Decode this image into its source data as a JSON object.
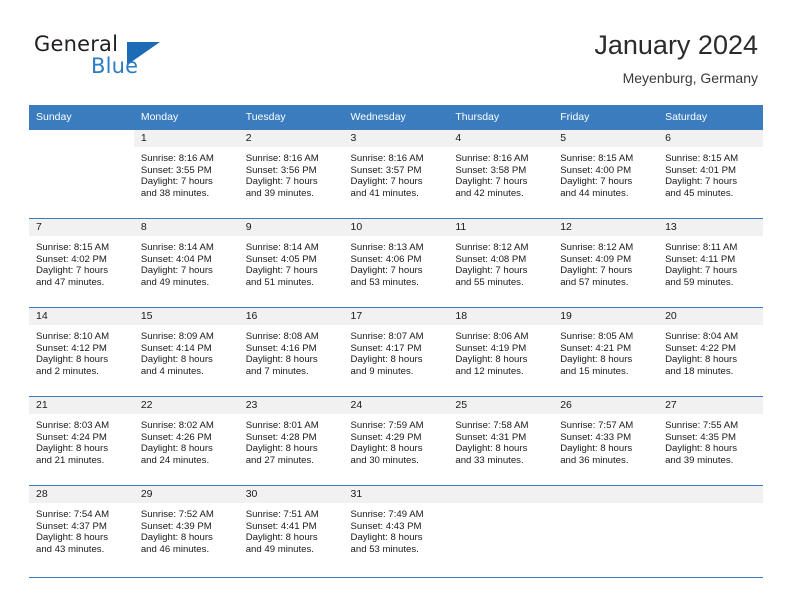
{
  "brand": {
    "line1": "General",
    "line2": "Blue",
    "accent_color": "#1b6cb5",
    "text_color": "#231f20"
  },
  "header": {
    "title": "January 2024",
    "subtitle": "Meyenburg, Germany"
  },
  "calendar": {
    "header_color": "#3a7cbe",
    "daynum_band_color": "#f1f1f1",
    "weekday_headers": [
      "Sunday",
      "Monday",
      "Tuesday",
      "Wednesday",
      "Thursday",
      "Friday",
      "Saturday"
    ],
    "weeks": [
      [
        {
          "day": "",
          "blank": true,
          "lines": []
        },
        {
          "day": "1",
          "lines": [
            "Sunrise: 8:16 AM",
            "Sunset: 3:55 PM",
            "Daylight: 7 hours",
            "and 38 minutes."
          ]
        },
        {
          "day": "2",
          "lines": [
            "Sunrise: 8:16 AM",
            "Sunset: 3:56 PM",
            "Daylight: 7 hours",
            "and 39 minutes."
          ]
        },
        {
          "day": "3",
          "lines": [
            "Sunrise: 8:16 AM",
            "Sunset: 3:57 PM",
            "Daylight: 7 hours",
            "and 41 minutes."
          ]
        },
        {
          "day": "4",
          "lines": [
            "Sunrise: 8:16 AM",
            "Sunset: 3:58 PM",
            "Daylight: 7 hours",
            "and 42 minutes."
          ]
        },
        {
          "day": "5",
          "lines": [
            "Sunrise: 8:15 AM",
            "Sunset: 4:00 PM",
            "Daylight: 7 hours",
            "and 44 minutes."
          ]
        },
        {
          "day": "6",
          "lines": [
            "Sunrise: 8:15 AM",
            "Sunset: 4:01 PM",
            "Daylight: 7 hours",
            "and 45 minutes."
          ]
        }
      ],
      [
        {
          "day": "7",
          "lines": [
            "Sunrise: 8:15 AM",
            "Sunset: 4:02 PM",
            "Daylight: 7 hours",
            "and 47 minutes."
          ]
        },
        {
          "day": "8",
          "lines": [
            "Sunrise: 8:14 AM",
            "Sunset: 4:04 PM",
            "Daylight: 7 hours",
            "and 49 minutes."
          ]
        },
        {
          "day": "9",
          "lines": [
            "Sunrise: 8:14 AM",
            "Sunset: 4:05 PM",
            "Daylight: 7 hours",
            "and 51 minutes."
          ]
        },
        {
          "day": "10",
          "lines": [
            "Sunrise: 8:13 AM",
            "Sunset: 4:06 PM",
            "Daylight: 7 hours",
            "and 53 minutes."
          ]
        },
        {
          "day": "11",
          "lines": [
            "Sunrise: 8:12 AM",
            "Sunset: 4:08 PM",
            "Daylight: 7 hours",
            "and 55 minutes."
          ]
        },
        {
          "day": "12",
          "lines": [
            "Sunrise: 8:12 AM",
            "Sunset: 4:09 PM",
            "Daylight: 7 hours",
            "and 57 minutes."
          ]
        },
        {
          "day": "13",
          "lines": [
            "Sunrise: 8:11 AM",
            "Sunset: 4:11 PM",
            "Daylight: 7 hours",
            "and 59 minutes."
          ]
        }
      ],
      [
        {
          "day": "14",
          "lines": [
            "Sunrise: 8:10 AM",
            "Sunset: 4:12 PM",
            "Daylight: 8 hours",
            "and 2 minutes."
          ]
        },
        {
          "day": "15",
          "lines": [
            "Sunrise: 8:09 AM",
            "Sunset: 4:14 PM",
            "Daylight: 8 hours",
            "and 4 minutes."
          ]
        },
        {
          "day": "16",
          "lines": [
            "Sunrise: 8:08 AM",
            "Sunset: 4:16 PM",
            "Daylight: 8 hours",
            "and 7 minutes."
          ]
        },
        {
          "day": "17",
          "lines": [
            "Sunrise: 8:07 AM",
            "Sunset: 4:17 PM",
            "Daylight: 8 hours",
            "and 9 minutes."
          ]
        },
        {
          "day": "18",
          "lines": [
            "Sunrise: 8:06 AM",
            "Sunset: 4:19 PM",
            "Daylight: 8 hours",
            "and 12 minutes."
          ]
        },
        {
          "day": "19",
          "lines": [
            "Sunrise: 8:05 AM",
            "Sunset: 4:21 PM",
            "Daylight: 8 hours",
            "and 15 minutes."
          ]
        },
        {
          "day": "20",
          "lines": [
            "Sunrise: 8:04 AM",
            "Sunset: 4:22 PM",
            "Daylight: 8 hours",
            "and 18 minutes."
          ]
        }
      ],
      [
        {
          "day": "21",
          "lines": [
            "Sunrise: 8:03 AM",
            "Sunset: 4:24 PM",
            "Daylight: 8 hours",
            "and 21 minutes."
          ]
        },
        {
          "day": "22",
          "lines": [
            "Sunrise: 8:02 AM",
            "Sunset: 4:26 PM",
            "Daylight: 8 hours",
            "and 24 minutes."
          ]
        },
        {
          "day": "23",
          "lines": [
            "Sunrise: 8:01 AM",
            "Sunset: 4:28 PM",
            "Daylight: 8 hours",
            "and 27 minutes."
          ]
        },
        {
          "day": "24",
          "lines": [
            "Sunrise: 7:59 AM",
            "Sunset: 4:29 PM",
            "Daylight: 8 hours",
            "and 30 minutes."
          ]
        },
        {
          "day": "25",
          "lines": [
            "Sunrise: 7:58 AM",
            "Sunset: 4:31 PM",
            "Daylight: 8 hours",
            "and 33 minutes."
          ]
        },
        {
          "day": "26",
          "lines": [
            "Sunrise: 7:57 AM",
            "Sunset: 4:33 PM",
            "Daylight: 8 hours",
            "and 36 minutes."
          ]
        },
        {
          "day": "27",
          "lines": [
            "Sunrise: 7:55 AM",
            "Sunset: 4:35 PM",
            "Daylight: 8 hours",
            "and 39 minutes."
          ]
        }
      ],
      [
        {
          "day": "28",
          "lines": [
            "Sunrise: 7:54 AM",
            "Sunset: 4:37 PM",
            "Daylight: 8 hours",
            "and 43 minutes."
          ]
        },
        {
          "day": "29",
          "lines": [
            "Sunrise: 7:52 AM",
            "Sunset: 4:39 PM",
            "Daylight: 8 hours",
            "and 46 minutes."
          ]
        },
        {
          "day": "30",
          "lines": [
            "Sunrise: 7:51 AM",
            "Sunset: 4:41 PM",
            "Daylight: 8 hours",
            "and 49 minutes."
          ]
        },
        {
          "day": "31",
          "lines": [
            "Sunrise: 7:49 AM",
            "Sunset: 4:43 PM",
            "Daylight: 8 hours",
            "and 53 minutes."
          ]
        },
        {
          "day": "",
          "empty": true,
          "lines": []
        },
        {
          "day": "",
          "empty": true,
          "lines": []
        },
        {
          "day": "",
          "empty": true,
          "lines": []
        }
      ]
    ]
  }
}
